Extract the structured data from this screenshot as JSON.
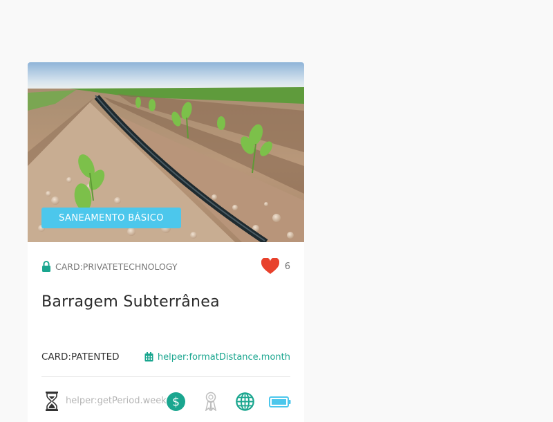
{
  "card": {
    "image": "irrigation-field-photo",
    "category_tag": "SANEAMENTO BÁSICO",
    "privacy_label": "CARD:PRIVATETECHNOLOGY",
    "likes_count": "6",
    "title": "Barragem Subterrânea",
    "patent_label": "CARD:PATENTED",
    "date_text": "helper:formatDistance.month",
    "period_text": "helper:getPeriod.week",
    "icons": [
      "lock-icon",
      "heart-icon",
      "calendar-icon",
      "hourglass-icon",
      "dollar-icon",
      "award-icon",
      "globe-icon",
      "battery-icon"
    ]
  },
  "colors": {
    "accent_green": "#1aa68f",
    "tag_blue": "#4cc7ec",
    "heart_red": "#e8412c"
  }
}
